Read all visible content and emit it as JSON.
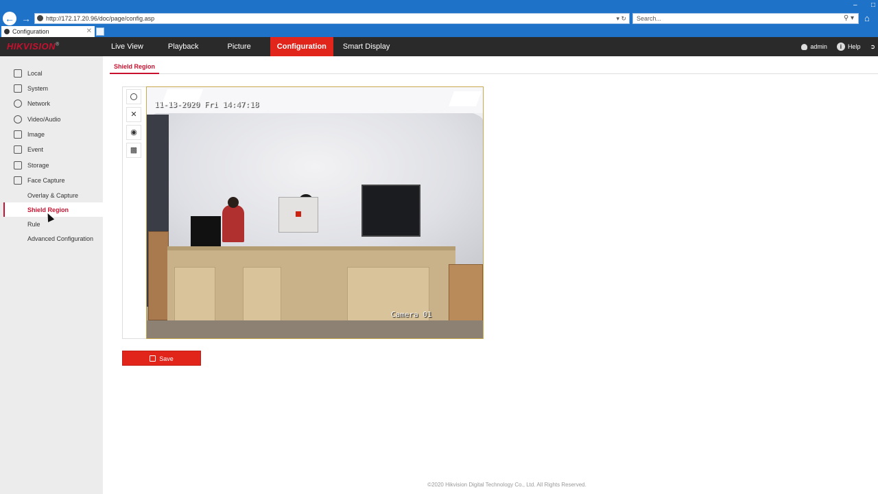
{
  "browser": {
    "url": "http://172.17.20.96/doc/page/config.asp",
    "search_placeholder": "Search...",
    "tab_title": "Configuration"
  },
  "header": {
    "logo": "HIKVISION",
    "nav": [
      {
        "label": "Live View",
        "active": false
      },
      {
        "label": "Playback",
        "active": false
      },
      {
        "label": "Picture",
        "active": false
      },
      {
        "label": "Configuration",
        "active": true
      },
      {
        "label": "Smart Display",
        "active": false
      }
    ],
    "user": "admin",
    "help": "Help"
  },
  "sidebar": {
    "items": [
      {
        "label": "Local",
        "icon": "monitor-icon"
      },
      {
        "label": "System",
        "icon": "system-icon"
      },
      {
        "label": "Network",
        "icon": "globe-icon"
      },
      {
        "label": "Video/Audio",
        "icon": "mic-icon"
      },
      {
        "label": "Image",
        "icon": "image-icon"
      },
      {
        "label": "Event",
        "icon": "calendar-icon"
      },
      {
        "label": "Storage",
        "icon": "storage-icon"
      },
      {
        "label": "Face Capture",
        "icon": "face-icon"
      }
    ],
    "sub_items": [
      {
        "label": "Overlay & Capture",
        "active": false
      },
      {
        "label": "Shield Region",
        "active": true
      },
      {
        "label": "Rule",
        "active": false
      },
      {
        "label": "Advanced Configuration",
        "active": false
      }
    ]
  },
  "content": {
    "tab": "Shield Region",
    "video": {
      "timestamp": "11-13-2020 Fri 14:47:18",
      "camera_label": "Camera 01"
    },
    "tools": [
      "draw-area-icon",
      "clear-icon",
      "snapshot-icon",
      "record-icon"
    ],
    "save_label": "Save"
  },
  "footer": "©2020 Hikvision Digital Technology Co., Ltd. All Rights Reserved.",
  "colors": {
    "accent": "#e1251b",
    "header_bg": "#2a2a2a",
    "browser_blue": "#1e73c8"
  }
}
